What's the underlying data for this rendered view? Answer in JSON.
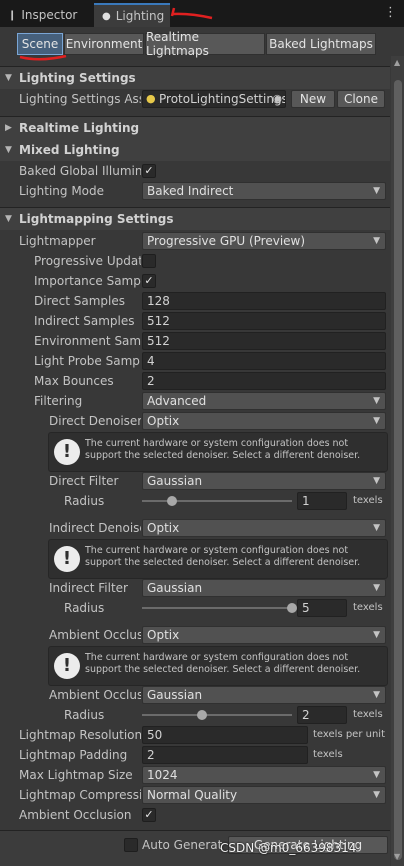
{
  "tabs": {
    "inspector": "Inspector",
    "lighting": "Lighting",
    "menu_icon": "kebab-menu-icon"
  },
  "subtabs": [
    "Scene",
    "Environment",
    "Realtime Lightmaps",
    "Baked Lightmaps"
  ],
  "sections": {
    "lighting_settings": "Lighting Settings",
    "realtime_lighting": "Realtime Lighting",
    "mixed_lighting": "Mixed Lighting",
    "lightmapping_settings": "Lightmapping Settings"
  },
  "lighting_settings": {
    "asset_label": "Lighting Settings Asset",
    "asset_value": "ProtoLightingSettings",
    "new_button": "New",
    "clone_button": "Clone"
  },
  "mixed": {
    "baked_gi_label": "Baked Global Illumination",
    "baked_gi_checked": true,
    "mode_label": "Lighting Mode",
    "mode_value": "Baked Indirect"
  },
  "lightmapping": {
    "lightmapper_label": "Lightmapper",
    "lightmapper_value": "Progressive GPU (Preview)",
    "progressive_updates_label": "Progressive Updates",
    "progressive_updates_checked": false,
    "importance_sampling_label": "Importance Sampling",
    "importance_sampling_checked": true,
    "direct_samples_label": "Direct Samples",
    "direct_samples_value": "128",
    "indirect_samples_label": "Indirect Samples",
    "indirect_samples_value": "512",
    "environment_samples_label": "Environment Samples",
    "environment_samples_value": "512",
    "light_probe_samples_label": "Light Probe Sample Multiplier",
    "light_probe_samples_value": "4",
    "max_bounces_label": "Max Bounces",
    "max_bounces_value": "2",
    "filtering_label": "Filtering",
    "filtering_value": "Advanced",
    "direct_denoiser_label": "Direct Denoiser",
    "direct_denoiser_value": "Optix",
    "denoiser_warning": "The current hardware or system configuration does not support the selected denoiser. Select a different denoiser.",
    "direct_filter_label": "Direct Filter",
    "direct_filter_value": "Gaussian",
    "direct_radius_label": "Radius",
    "direct_radius_value": "1",
    "direct_radius_level": 0.2,
    "indirect_denoiser_label": "Indirect Denoiser",
    "indirect_denoiser_value": "Optix",
    "indirect_filter_label": "Indirect Filter",
    "indirect_filter_value": "Gaussian",
    "indirect_radius_label": "Radius",
    "indirect_radius_value": "5",
    "indirect_radius_level": 1.0,
    "ao_denoiser_label": "Ambient Occlusion Denoiser",
    "ao_denoiser_value": "Optix",
    "ao_filter_label": "Ambient Occlusion Filter",
    "ao_filter_value": "Gaussian",
    "ao_radius_label": "Radius",
    "ao_radius_value": "2",
    "ao_radius_level": 0.4,
    "texels_unit": "texels",
    "resolution_label": "Lightmap Resolution",
    "resolution_value": "50",
    "resolution_unit": "texels per unit",
    "padding_label": "Lightmap Padding",
    "padding_value": "2",
    "padding_unit": "texels",
    "max_size_label": "Max Lightmap Size",
    "max_size_value": "1024",
    "compression_label": "Lightmap Compression",
    "compression_value": "Normal Quality",
    "ambient_occlusion_label": "Ambient Occlusion",
    "ambient_occlusion_checked": true
  },
  "footer": {
    "auto_generate_label": "Auto Generate",
    "generate_button": "Generate Lighting",
    "watermark": "CSDN @m0_66398314"
  },
  "colors": {
    "accent": "#3a79bb",
    "annotation": "#e02020"
  }
}
